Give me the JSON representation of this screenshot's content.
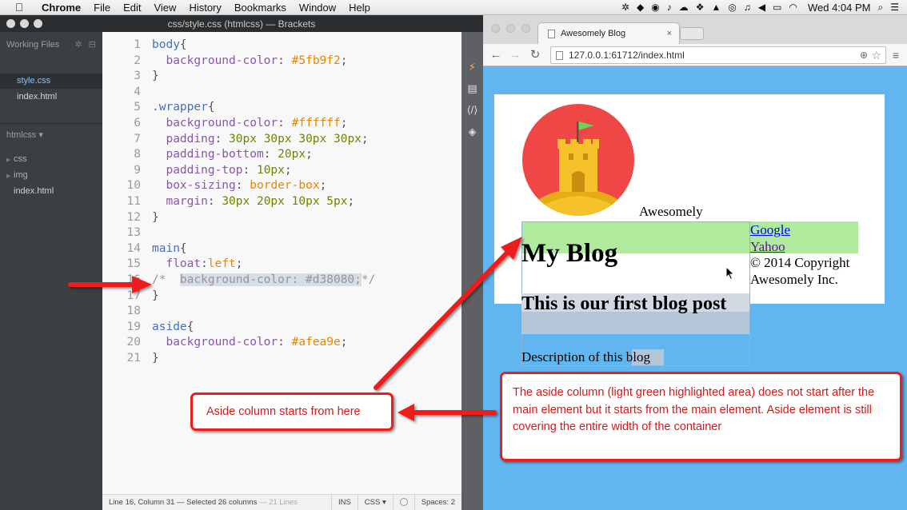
{
  "menubar": {
    "app": "Chrome",
    "items": [
      "File",
      "Edit",
      "View",
      "History",
      "Bookmarks",
      "Window",
      "Help"
    ],
    "status_icons": [
      "gear-icon",
      "evernote-icon",
      "record-icon",
      "bell-icon",
      "cloud-icon",
      "dropbox-icon",
      "drive-icon",
      "creative-cloud-icon",
      "notification-icon",
      "volume-icon",
      "battery-icon",
      "wifi-icon"
    ],
    "clock": "Wed 4:04 PM"
  },
  "brackets": {
    "title": "css/style.css (htmlcss) — Brackets",
    "working_files_label": "Working Files",
    "working_files": [
      "style.css",
      "index.html"
    ],
    "project": "htmlcss ▾",
    "tree": [
      {
        "label": "css",
        "type": "folder"
      },
      {
        "label": "img",
        "type": "folder"
      },
      {
        "label": "index.html",
        "type": "file"
      }
    ],
    "code": [
      {
        "n": "1",
        "t": [
          [
            "sel",
            "body"
          ],
          [
            "txt",
            "{"
          ]
        ]
      },
      {
        "n": "2",
        "t": [
          [
            "txt",
            "  "
          ],
          [
            "prop",
            "background-color"
          ],
          [
            "txt",
            ": "
          ],
          [
            "val",
            "#5fb9f2"
          ],
          [
            "txt",
            ";"
          ]
        ]
      },
      {
        "n": "3",
        "t": [
          [
            "txt",
            "}"
          ]
        ]
      },
      {
        "n": "4",
        "t": []
      },
      {
        "n": "5",
        "t": [
          [
            "sel",
            ".wrapper"
          ],
          [
            "txt",
            "{"
          ]
        ]
      },
      {
        "n": "6",
        "t": [
          [
            "txt",
            "  "
          ],
          [
            "prop",
            "background-color"
          ],
          [
            "txt",
            ": "
          ],
          [
            "val",
            "#ffffff"
          ],
          [
            "txt",
            ";"
          ]
        ]
      },
      {
        "n": "7",
        "t": [
          [
            "txt",
            "  "
          ],
          [
            "prop",
            "padding"
          ],
          [
            "txt",
            ": "
          ],
          [
            "num",
            "30px 30px 30px 30px"
          ],
          [
            "txt",
            ";"
          ]
        ]
      },
      {
        "n": "8",
        "t": [
          [
            "txt",
            "  "
          ],
          [
            "prop",
            "padding-bottom"
          ],
          [
            "txt",
            ": "
          ],
          [
            "num",
            "20px"
          ],
          [
            "txt",
            ";"
          ]
        ]
      },
      {
        "n": "9",
        "t": [
          [
            "txt",
            "  "
          ],
          [
            "prop",
            "padding-top"
          ],
          [
            "txt",
            ": "
          ],
          [
            "num",
            "10px"
          ],
          [
            "txt",
            ";"
          ]
        ]
      },
      {
        "n": "10",
        "t": [
          [
            "txt",
            "  "
          ],
          [
            "prop",
            "box-sizing"
          ],
          [
            "txt",
            ": "
          ],
          [
            "val",
            "border-box"
          ],
          [
            "txt",
            ";"
          ]
        ]
      },
      {
        "n": "11",
        "t": [
          [
            "txt",
            "  "
          ],
          [
            "prop",
            "margin"
          ],
          [
            "txt",
            ": "
          ],
          [
            "num",
            "30px 20px 10px 5px"
          ],
          [
            "txt",
            ";"
          ]
        ]
      },
      {
        "n": "12",
        "t": [
          [
            "txt",
            "}"
          ]
        ]
      },
      {
        "n": "13",
        "t": []
      },
      {
        "n": "14",
        "t": [
          [
            "sel",
            "main"
          ],
          [
            "txt",
            "{"
          ]
        ]
      },
      {
        "n": "15",
        "t": [
          [
            "txt",
            "  "
          ],
          [
            "prop",
            "float"
          ],
          [
            "txt",
            ":"
          ],
          [
            "val",
            "left"
          ],
          [
            "txt",
            ";"
          ]
        ]
      },
      {
        "n": "16",
        "t": [
          [
            "com",
            "/*  "
          ],
          [
            "comhl",
            "background-color: #d38080;"
          ],
          [
            "com",
            "*/"
          ]
        ]
      },
      {
        "n": "17",
        "t": [
          [
            "txt",
            "}"
          ]
        ]
      },
      {
        "n": "18",
        "t": []
      },
      {
        "n": "19",
        "t": [
          [
            "sel",
            "aside"
          ],
          [
            "txt",
            "{"
          ]
        ]
      },
      {
        "n": "20",
        "t": [
          [
            "txt",
            "  "
          ],
          [
            "prop",
            "background-color"
          ],
          [
            "txt",
            ": "
          ],
          [
            "val",
            "#afea9e"
          ],
          [
            "txt",
            ";"
          ]
        ]
      },
      {
        "n": "21",
        "t": [
          [
            "txt",
            "}"
          ]
        ]
      }
    ],
    "status": {
      "position": "Line 16, Column 31 — Selected 26 columns",
      "lines": "— 21 Lines",
      "mode": "INS",
      "language": "CSS ▾",
      "spaces": "Spaces: 2"
    },
    "colors": {
      "sidebar": "#3c3f41",
      "editor_bg": "#f8f8f8",
      "selector": "#446fbd",
      "property": "#8757ad",
      "value": "#e88501",
      "number": "#6d8600"
    }
  },
  "chrome": {
    "tab_title": "Awesomely Blog",
    "tab_close": "×",
    "url": "127.0.0.1:61712/index.html",
    "page": {
      "site_title": "Awesomely",
      "links": [
        "Google",
        "Yahoo"
      ],
      "copyright": "© 2014 Copyright Awesomely Inc.",
      "heading": "My Blog",
      "post_title": "This is our first blog post",
      "post_desc": "Description of this blog"
    },
    "colors": {
      "body_bg": "#5fb9f2",
      "aside_bg": "#afea9e",
      "wrapper_bg": "#ffffff"
    }
  },
  "annotations": {
    "left": "Aside column starts from here",
    "right": "The aside column (light green highlighted area) does not start after the main element but it starts from the main element. Aside element is still covering the entire width of the container",
    "color": "#ee1c1c"
  }
}
